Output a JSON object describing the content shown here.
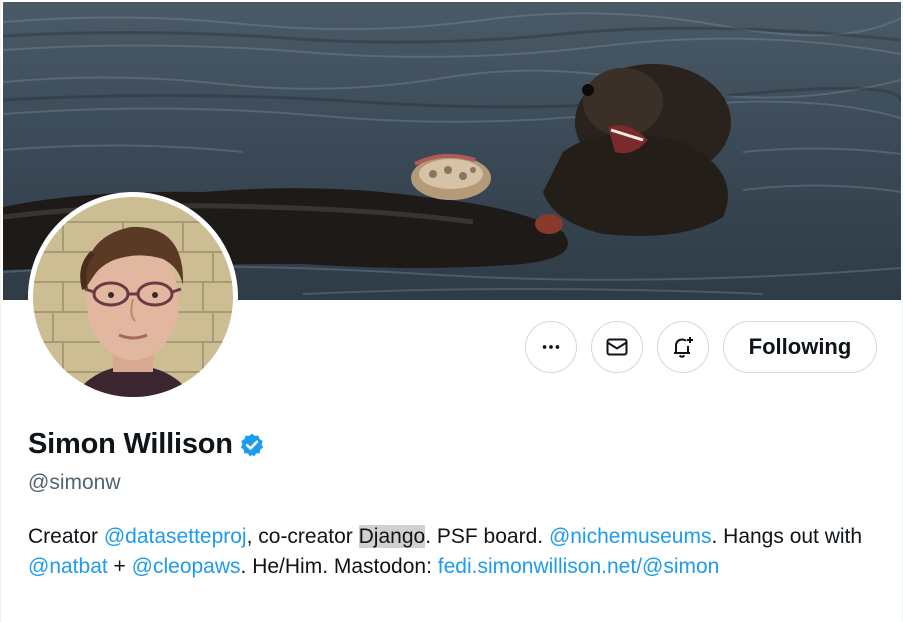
{
  "banner": {
    "alt": "Sea otter floating in water eating a shellfish"
  },
  "avatar": {
    "alt": "Profile photo"
  },
  "actions": {
    "more_icon": "more-dots-icon",
    "message_icon": "mail-icon",
    "notify_icon": "bell-plus-icon",
    "follow_label": "Following"
  },
  "profile": {
    "display_name": "Simon Willison",
    "verified_icon": "verified-badge-icon",
    "handle": "@simonw"
  },
  "bio": {
    "t1": "Creator ",
    "l1": "@datasetteproj",
    "t2": ", co-creator ",
    "hl": "Django",
    "t3": ". PSF board. ",
    "l2": "@nichemuseums",
    "t4": ". Hangs out with ",
    "l3": "@natbat",
    "t5": " + ",
    "l4": "@cleopaws",
    "t6": ". He/Him. Mastodon: ",
    "l5": "fedi.simonwillison.net/@simon"
  },
  "colors": {
    "link": "#1d9bf0",
    "verified": "#1d9bf0",
    "text": "#0f1419",
    "secondary": "#536471",
    "border": "#cfd9de"
  }
}
